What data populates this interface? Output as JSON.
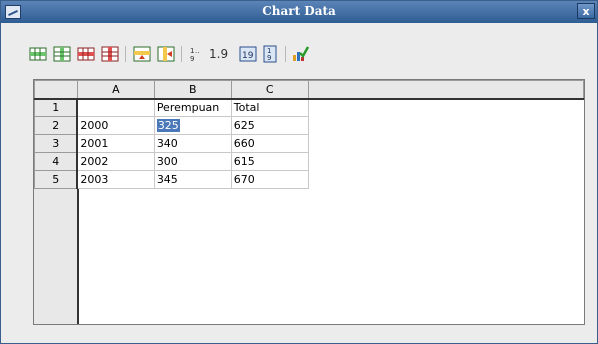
{
  "window": {
    "title": "Chart Data",
    "close_label": "x"
  },
  "toolbar": {
    "icons": [
      "insert-row-icon",
      "insert-series-icon",
      "delete-row-icon",
      "delete-series-icon",
      "move-row-down-icon",
      "move-series-right-icon",
      "number-format-fraction-icon",
      "number-format-decimal-icon",
      "number-format-19-icon",
      "number-format-stacked-icon",
      "chart-check-icon"
    ],
    "fraction_label": "1..9",
    "decimal_label": "1.9",
    "box19_label": "19"
  },
  "table": {
    "column_headers": [
      "",
      "A",
      "B",
      "C",
      ""
    ],
    "rows": [
      {
        "num": "1",
        "cells": [
          "",
          "Perempuan",
          "Total"
        ]
      },
      {
        "num": "2",
        "cells": [
          "2000",
          "325",
          "625"
        ]
      },
      {
        "num": "3",
        "cells": [
          "2001",
          "340",
          "660"
        ]
      },
      {
        "num": "4",
        "cells": [
          "2002",
          "300",
          "615"
        ]
      },
      {
        "num": "5",
        "cells": [
          "2003",
          "345",
          "670"
        ]
      }
    ]
  },
  "colors": {
    "title_bar": "#2e5d93",
    "selection": "#4a78b8"
  }
}
